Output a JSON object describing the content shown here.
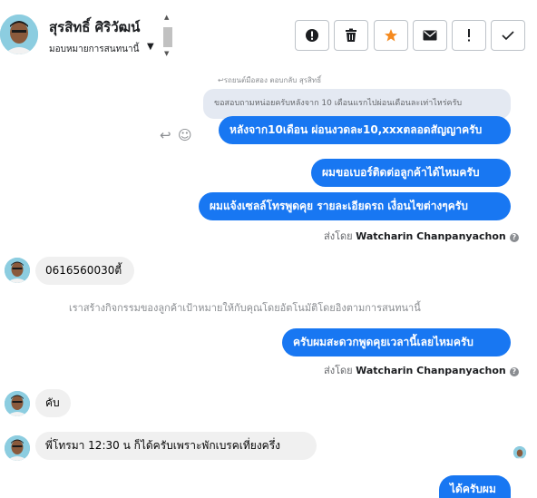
{
  "header": {
    "contact_name": "สุรสิทธิ์ ศิริวัฒน์",
    "assign_label": "มอบหมายการสนทนานี้",
    "assign_caret": "▼",
    "actions": [
      {
        "name": "report-button",
        "icon": "exclamation-circle-icon"
      },
      {
        "name": "delete-button",
        "icon": "trash-icon"
      },
      {
        "name": "star-button",
        "icon": "star-icon",
        "color": "#f58a1f"
      },
      {
        "name": "mark-unread-button",
        "icon": "envelope-icon"
      },
      {
        "name": "spam-button",
        "icon": "exclamation-icon"
      },
      {
        "name": "done-button",
        "icon": "check-icon"
      }
    ]
  },
  "thread": {
    "reply_meta": "↩รถยนต์มือสอง ตอบกลับ สุรสิทธิ์",
    "quoted_text": "ขอสอบถามหน่อยครับหลังจาก 10 เดือนแรกไปผ่อนเดือนละเท่าไหร่ครับ",
    "msg_tools": {
      "reply_icon": "↩",
      "emoji_icon": "☺"
    },
    "messages": [
      {
        "dir": "out",
        "text": "หลังจาก10เดือน ผ่อนงวดละ10,xxxตลอดสัญญาครับ"
      },
      {
        "dir": "out",
        "text": "ผมขอเบอร์ติดต่อลูกค้าได้ไหมครับ"
      },
      {
        "dir": "out",
        "text": "ผมแจ้งเซลล์โทรพูดคุย รายละเอียดรถ เงื่อนไขต่างๆครับ"
      },
      {
        "dir": "in",
        "text": "0616560030ตี้"
      },
      {
        "dir": "out",
        "text": "ครับผมสะดวกพูดคุยเวลานี้เลยไหมครับ"
      },
      {
        "dir": "in",
        "text": "คับ"
      },
      {
        "dir": "in",
        "text": "พี่โทรมา 12:30 น ก็ได้ครับเพราะพักเบรคเที่ยงครึ่ง"
      },
      {
        "dir": "out",
        "text": "ได้ครับผม"
      }
    ],
    "sent_by_prefix": "ส่งโดย",
    "sent_by_name": "Watcharin Chanpanyachon",
    "help_mark": "?",
    "system_note": "เราสร้างกิจกรรมของลูกค้าเป้าหมายให้กับคุณโดยอัตโนมัติโดยอิงตามการสนทนานี้",
    "colors": {
      "outgoing": "#1877f2",
      "incoming": "#f0f0f0",
      "quoted": "#e4e9f2"
    }
  }
}
